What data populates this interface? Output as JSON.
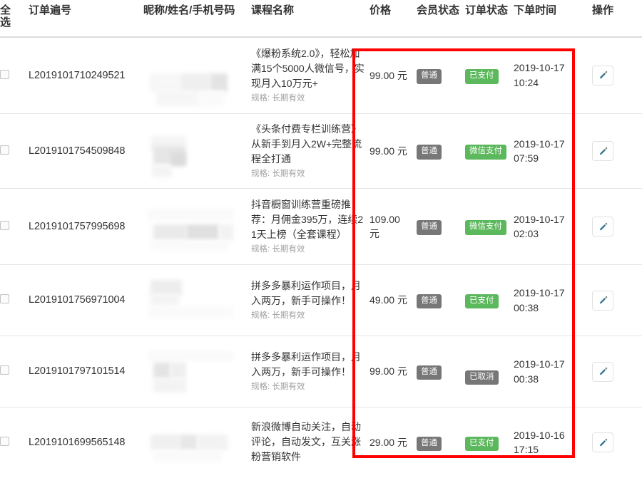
{
  "table": {
    "columns": [
      {
        "key": "select",
        "label": "全选"
      },
      {
        "key": "order",
        "label": "订单遍号"
      },
      {
        "key": "nick",
        "label": "昵称/姓名/手机号码"
      },
      {
        "key": "course",
        "label": "课程名称"
      },
      {
        "key": "price",
        "label": "价格"
      },
      {
        "key": "member",
        "label": "会员状态"
      },
      {
        "key": "status",
        "label": "订单状态"
      },
      {
        "key": "time",
        "label": "下单时间"
      },
      {
        "key": "action",
        "label": "操作"
      }
    ],
    "rows": [
      {
        "order_id": "L2019101710249521",
        "nickname": "",
        "course": "《爆粉系统2.0》，轻松加满15个5000人微信号，实现月入10万元+",
        "spec": "规格: 长期有效",
        "price": "99.00 元",
        "member_status": "普通",
        "order_status": "已支付",
        "order_status_type": "success",
        "order_time": "2019-10-17 10:24",
        "action": "edit-icon"
      },
      {
        "order_id": "L2019101754509848",
        "nickname": "",
        "course": "《头条付费专栏训练营》从新手到月入2W+完整流程全打通",
        "spec": "规格: 长期有效",
        "price": "99.00 元",
        "member_status": "普通",
        "order_status": "微信支付",
        "order_status_type": "success",
        "order_time": "2019-10-17 07:59",
        "action": "edit-icon"
      },
      {
        "order_id": "L2019101757995698",
        "nickname": "",
        "course": "抖音橱窗训练营重磅推荐：月佣金395万，连续21天上榜（全套课程）",
        "spec": "规格: 长期有效",
        "price": "109.00 元",
        "member_status": "普通",
        "order_status": "微信支付",
        "order_status_type": "success",
        "order_time": "2019-10-17 02:03",
        "action": "edit-icon"
      },
      {
        "order_id": "L2019101756971004",
        "nickname": "",
        "course": "拼多多暴利运作项目，月入两万，新手可操作！",
        "spec": "规格: 长期有效",
        "price": "49.00 元",
        "member_status": "普通",
        "order_status": "已支付",
        "order_status_type": "success",
        "order_time": "2019-10-17 00:38",
        "action": "edit-icon"
      },
      {
        "order_id": "L2019101797101514",
        "nickname": "",
        "course": "拼多多暴利运作项目，月入两万，新手可操作！",
        "spec": "规格: 长期有效",
        "price": "99.00 元",
        "member_status": "普通",
        "order_status": "已取消",
        "order_status_type": "default",
        "order_time": "2019-10-17 00:38",
        "action": "edit-icon"
      },
      {
        "order_id": "L2019101699565148",
        "nickname": "",
        "course": "新浪微博自动关注，自动评论，自动发文，互关涨粉营销软件",
        "spec": "",
        "price": "29.00 元",
        "member_status": "普通",
        "order_status": "已支付",
        "order_status_type": "success",
        "order_time": "2019-10-16 17:15",
        "action": "edit-icon"
      }
    ]
  },
  "colors": {
    "badge_default": "#777777",
    "badge_success": "#5cb85c",
    "annotation": "#fe0000",
    "header_border": "#dddddd",
    "row_border": "#e6e6e6"
  },
  "annotation": {
    "name": "highlight-rectangle",
    "shape": "rectangle",
    "color": "#fe0000"
  }
}
